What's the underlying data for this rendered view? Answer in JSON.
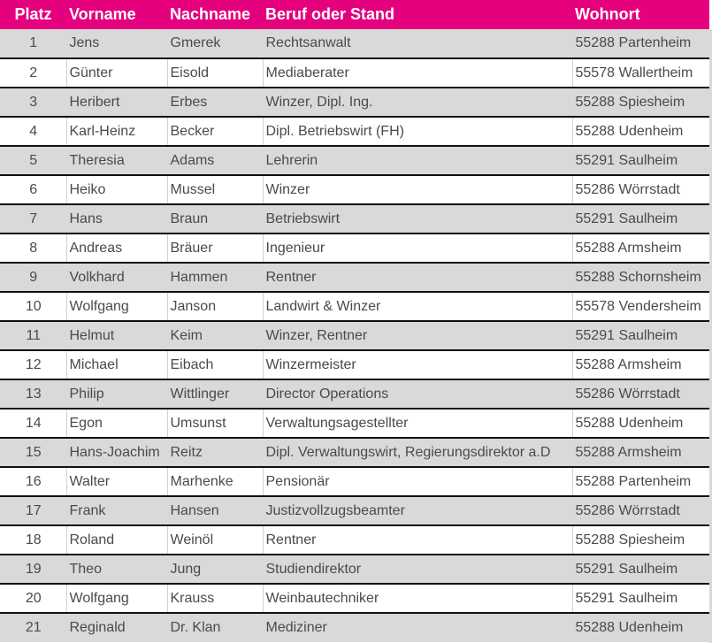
{
  "table": {
    "headers": [
      "Platz",
      "Vorname",
      "Nachname",
      "Beruf oder Stand",
      "Wohnort"
    ],
    "header_color": "#e5007d",
    "stripe_color": "#d9d9d9",
    "rows": [
      [
        "1",
        "Jens",
        "Gmerek",
        "Rechtsanwalt",
        "55288 Partenheim"
      ],
      [
        "2",
        "Günter",
        "Eisold",
        "Mediaberater",
        "55578 Wallertheim"
      ],
      [
        "3",
        "Heribert",
        "Erbes",
        "Winzer, Dipl. Ing.",
        "55288 Spiesheim"
      ],
      [
        "4",
        "Karl-Heinz",
        "Becker",
        "Dipl. Betriebswirt (FH)",
        "55288 Udenheim"
      ],
      [
        "5",
        "Theresia",
        "Adams",
        "Lehrerin",
        "55291 Saulheim"
      ],
      [
        "6",
        "Heiko",
        "Mussel",
        "Winzer",
        "55286 Wörrstadt"
      ],
      [
        "7",
        "Hans",
        "Braun",
        "Betriebswirt",
        "55291 Saulheim"
      ],
      [
        "8",
        "Andreas",
        "Bräuer",
        "Ingenieur",
        "55288 Armsheim"
      ],
      [
        "9",
        "Volkhard",
        "Hammen",
        "Rentner",
        "55288 Schornsheim"
      ],
      [
        "10",
        "Wolfgang",
        "Janson",
        "Landwirt & Winzer",
        "55578 Vendersheim"
      ],
      [
        "11",
        "Helmut",
        "Keim",
        "Winzer, Rentner",
        "55291 Saulheim"
      ],
      [
        "12",
        "Michael",
        "Eibach",
        "Winzermeister",
        "55288 Armsheim"
      ],
      [
        "13",
        "Philip",
        "Wittlinger",
        "Director Operations",
        "55286 Wörrstadt"
      ],
      [
        "14",
        "Egon",
        "Umsunst",
        "Verwaltungsagestellter",
        "55288 Udenheim"
      ],
      [
        "15",
        "Hans-Joachim",
        "Reitz",
        "Dipl. Verwaltungswirt, Regierungsdirektor a.D",
        "55288 Armsheim"
      ],
      [
        "16",
        "Walter",
        "Marhenke",
        "Pensionär",
        "55288 Partenheim"
      ],
      [
        "17",
        "Frank",
        "Hansen",
        "Justizvollzugsbeamter",
        "55286 Wörrstadt"
      ],
      [
        "18",
        "Roland",
        "Weinöl",
        "Rentner",
        "55288 Spiesheim"
      ],
      [
        "19",
        "Theo",
        "Jung",
        "Studiendirektor",
        "55291 Saulheim"
      ],
      [
        "20",
        "Wolfgang",
        "Krauss",
        "Weinbautechniker",
        "55291 Saulheim"
      ],
      [
        "21",
        "Reginald",
        "Dr. Klan",
        "Mediziner",
        "55288 Udenheim"
      ]
    ]
  }
}
